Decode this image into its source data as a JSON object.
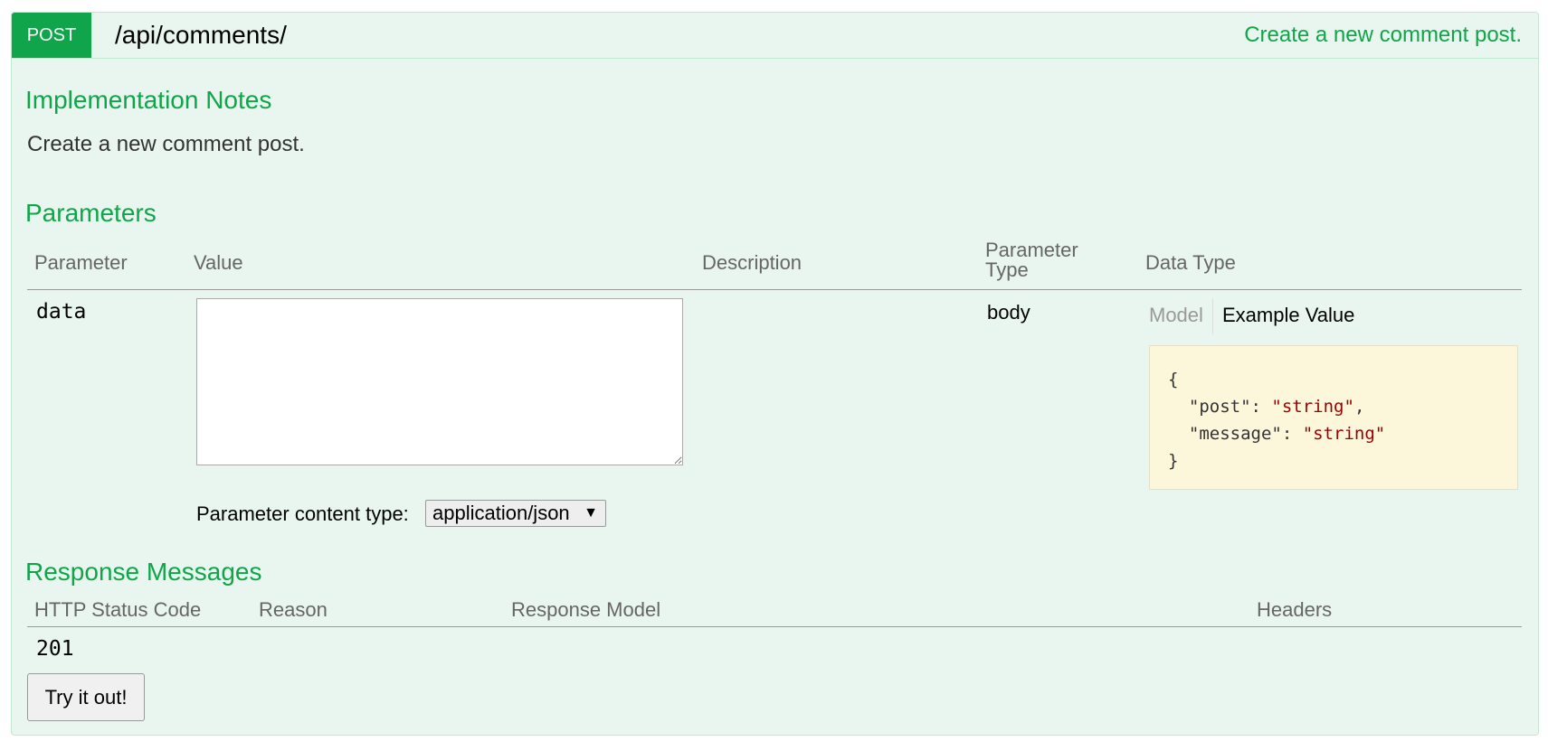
{
  "operation": {
    "method": "POST",
    "path": "/api/comments/",
    "summary": "Create a new comment post."
  },
  "implementation_notes": {
    "heading": "Implementation Notes",
    "text": "Create a new comment post."
  },
  "parameters": {
    "heading": "Parameters",
    "columns": {
      "parameter": "Parameter",
      "value": "Value",
      "description": "Description",
      "parameter_type_line1": "Parameter",
      "parameter_type_line2": "Type",
      "data_type": "Data Type"
    },
    "rows": [
      {
        "name": "data",
        "value": "",
        "description": "",
        "parameter_type": "body",
        "data_type": {
          "tabs": {
            "model": "Model",
            "example": "Example Value"
          },
          "active_tab": "Example Value",
          "example": {
            "open_brace": "{",
            "key1": "\"post\"",
            "val1": "\"string\"",
            "key2": "\"message\"",
            "val2": "\"string\"",
            "close_brace": "}"
          }
        }
      }
    ],
    "content_type": {
      "label": "Parameter content type:",
      "selected": "application/json",
      "arrow": "▼"
    }
  },
  "response_messages": {
    "heading": "Response Messages",
    "columns": {
      "status": "HTTP Status Code",
      "reason": "Reason",
      "model": "Response Model",
      "headers": "Headers"
    },
    "rows": [
      {
        "status": "201",
        "reason": "",
        "model": "",
        "headers": ""
      }
    ]
  },
  "try_button": {
    "label": "Try it out!"
  },
  "colors": {
    "accent": "#10a54a",
    "panel_bg": "#e9f6ef",
    "panel_border": "#c3e8d1",
    "snippet_bg": "#fcf6db",
    "string_value": "#990000"
  }
}
